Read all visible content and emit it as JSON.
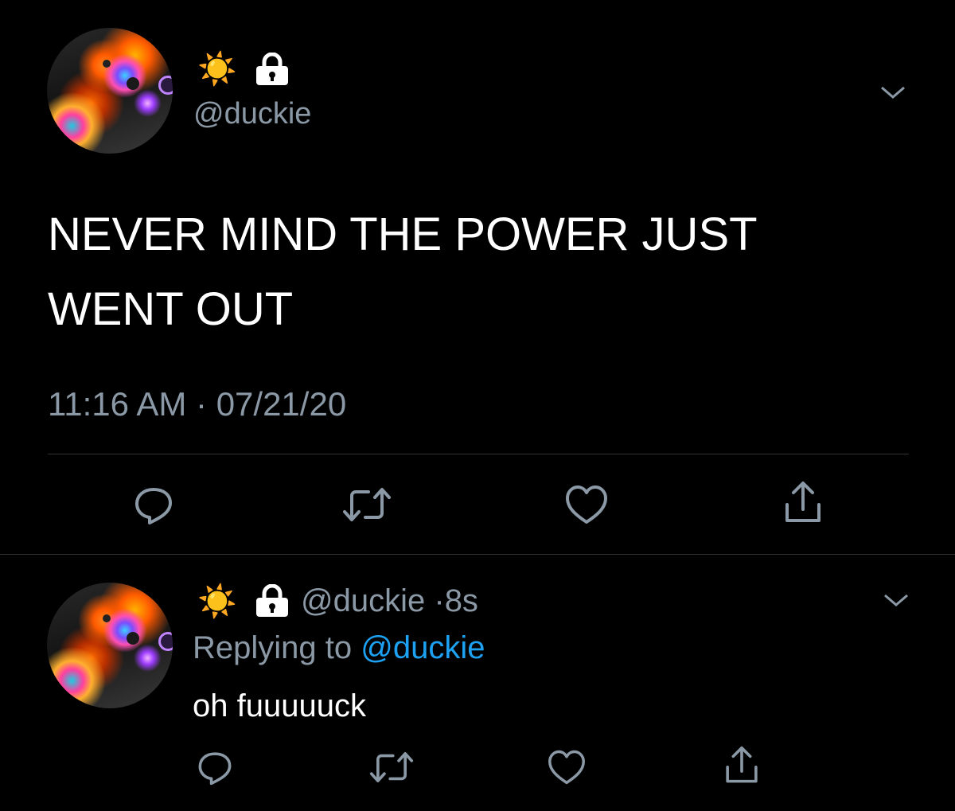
{
  "tweet": {
    "display_name_emoji": "☀️",
    "handle": "@duckie",
    "text_line1": "NEVER MIND THE POWER JUST",
    "text_line2": "WENT OUT",
    "time": "11:16 AM",
    "separator": "·",
    "date": "07/21/20",
    "icons": [
      "sun-icon",
      "lock-icon",
      "chevron-down-icon",
      "reply-icon",
      "retweet-icon",
      "like-icon",
      "share-icon"
    ]
  },
  "reply": {
    "display_name_emoji": "☀️",
    "handle": "@duckie",
    "separator": "·",
    "time_ago": "8s",
    "replying_to_prefix": "Replying to",
    "replying_to_handle": "@duckie",
    "text": "oh fuuuuuck"
  },
  "colors": {
    "background": "#000000",
    "text": "#ffffff",
    "secondary": "#8b98a5",
    "link": "#1da1f2",
    "divider": "#2f3336"
  }
}
